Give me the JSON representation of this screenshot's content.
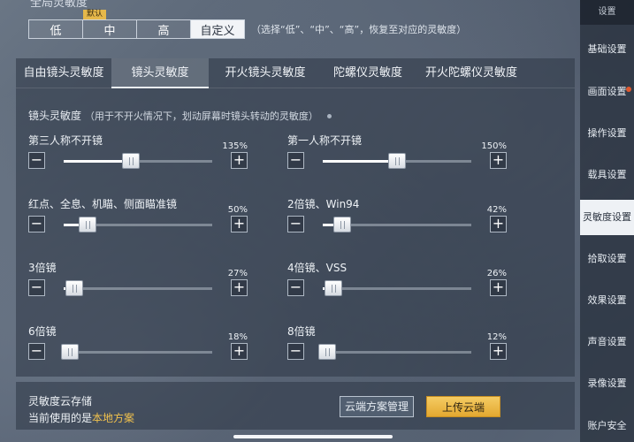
{
  "global": {
    "title": "全局灵敏度",
    "presets": [
      {
        "label": "低",
        "active": false
      },
      {
        "label": "中",
        "active": false,
        "tag": "默认"
      },
      {
        "label": "高",
        "active": false
      },
      {
        "label": "自定义",
        "active": true
      }
    ],
    "hint": "（选择“低”、“中”、“高”，恢复至对应的灵敏度）"
  },
  "tabs": [
    {
      "label": "自由镜头灵敏度",
      "active": false
    },
    {
      "label": "镜头灵敏度",
      "active": true
    },
    {
      "label": "开火镜头灵敏度",
      "active": false
    },
    {
      "label": "陀螺仪灵敏度",
      "active": false
    },
    {
      "label": "开火陀螺仪灵敏度",
      "active": false
    }
  ],
  "section": {
    "title": "镜头灵敏度",
    "subtitle": "（用于不开火情况下，划动屏幕时镜头转动的灵敏度）"
  },
  "sliders": [
    {
      "label": "第三人称不开镜",
      "value": "135%",
      "fraction": 0.45
    },
    {
      "label": "第一人称不开镜",
      "value": "150%",
      "fraction": 0.5
    },
    {
      "label": "红点、全息、机瞄、侧面瞄准镜",
      "value": "50%",
      "fraction": 0.16
    },
    {
      "label": "2倍镜、Win94",
      "value": "42%",
      "fraction": 0.13
    },
    {
      "label": "3倍镜",
      "value": "27%",
      "fraction": 0.07
    },
    {
      "label": "4倍镜、VSS",
      "value": "26%",
      "fraction": 0.07
    },
    {
      "label": "6倍镜",
      "value": "18%",
      "fraction": 0.04
    },
    {
      "label": "8倍镜",
      "value": "12%",
      "fraction": 0.03
    }
  ],
  "stepper": {
    "minus": "−",
    "plus": "+"
  },
  "cloud": {
    "title": "灵敏度云存储",
    "current_prefix": "当前使用的是",
    "current_value": "本地方案",
    "manage_label": "云端方案管理",
    "upload_label": "上传云端"
  },
  "sidebar": {
    "header": "设置",
    "items": [
      {
        "label": "基础设置",
        "active": false,
        "dot": false
      },
      {
        "label": "画面设置",
        "active": false,
        "dot": true
      },
      {
        "label": "操作设置",
        "active": false,
        "dot": false
      },
      {
        "label": "载具设置",
        "active": false,
        "dot": false
      },
      {
        "label": "灵敏度设置",
        "active": true,
        "dot": false
      },
      {
        "label": "拾取设置",
        "active": false,
        "dot": false
      },
      {
        "label": "效果设置",
        "active": false,
        "dot": false
      },
      {
        "label": "声音设置",
        "active": false,
        "dot": false
      },
      {
        "label": "录像设置",
        "active": false,
        "dot": false
      },
      {
        "label": "账户安全",
        "active": false,
        "dot": false
      }
    ]
  }
}
